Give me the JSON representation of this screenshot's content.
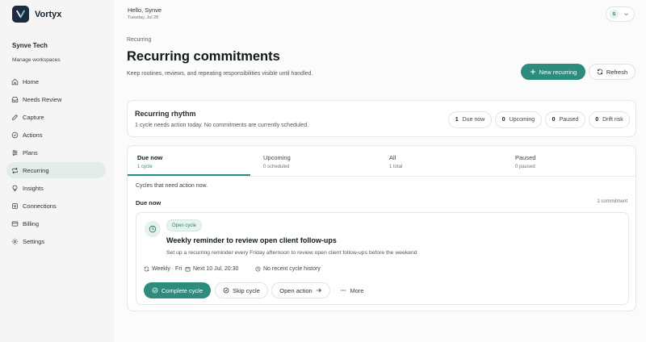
{
  "app": {
    "name": "Vortyx"
  },
  "sidebar": {
    "org_name": "Synve Tech",
    "manage_label": "Manage workspaces",
    "items": [
      {
        "label": "Home",
        "icon": "home-icon"
      },
      {
        "label": "Needs Review",
        "icon": "inbox-icon"
      },
      {
        "label": "Capture",
        "icon": "pen-icon"
      },
      {
        "label": "Actions",
        "icon": "check-circle-icon"
      },
      {
        "label": "Plans",
        "icon": "sliders-icon"
      },
      {
        "label": "Recurring",
        "icon": "repeat-icon",
        "active": true
      },
      {
        "label": "Insights",
        "icon": "lightbulb-icon"
      },
      {
        "label": "Connections",
        "icon": "plug-icon"
      },
      {
        "label": "Billing",
        "icon": "card-icon"
      },
      {
        "label": "Settings",
        "icon": "gear-icon"
      }
    ]
  },
  "header": {
    "greeting": "Hello, Synve",
    "date": "Tuesday, Jul 28",
    "avatar_initial": "S"
  },
  "page": {
    "breadcrumb": "Recurring",
    "title": "Recurring commitments",
    "subtitle": "Keep routines, reviews, and repeating responsibilities visible until handled.",
    "new_button": "New recurring",
    "refresh_button": "Refresh"
  },
  "rhythm": {
    "title": "Recurring rhythm",
    "description": "1 cycle needs action today. No commitments are currently scheduled.",
    "stats": [
      {
        "count": "1",
        "label": "Due now"
      },
      {
        "count": "0",
        "label": "Upcoming"
      },
      {
        "count": "0",
        "label": "Paused"
      },
      {
        "count": "0",
        "label": "Drift risk"
      }
    ]
  },
  "tabs": [
    {
      "label": "Due now",
      "count": "1 cycle",
      "active": true
    },
    {
      "label": "Upcoming",
      "count": "0 scheduled"
    },
    {
      "label": "All",
      "count": "1 total"
    },
    {
      "label": "Paused",
      "count": "0 paused"
    }
  ],
  "due": {
    "note": "Cycles that need action now.",
    "section_label": "Due now",
    "section_count": "1 commitment",
    "card": {
      "badge": "Open cycle",
      "title": "Weekly reminder to review open client follow-ups",
      "description": "Set up a recurring reminder every Friday afternoon to review open client follow-ups before the weekend",
      "frequency": "Weekly · Fri",
      "next": "Next 10 Jul, 20:30",
      "history": "No recent cycle history",
      "complete_button": "Complete cycle",
      "skip_button": "Skip cycle",
      "open_button": "Open action",
      "more_button": "More"
    }
  },
  "colors": {
    "accent": "#2d8c7d",
    "logo_bg": "#1c2b3d",
    "active_nav": "#e3ecea"
  }
}
